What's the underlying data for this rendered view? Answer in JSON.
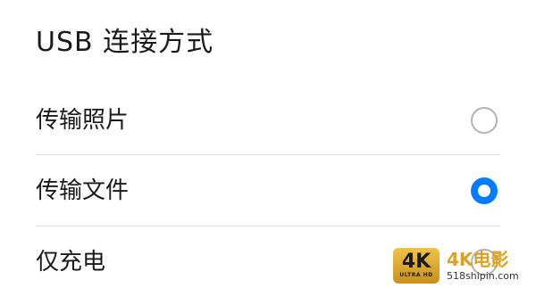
{
  "dialog": {
    "title": "USB 连接方式",
    "options": [
      {
        "label": "传输照片",
        "selected": false
      },
      {
        "label": "传输文件",
        "selected": true
      },
      {
        "label": "仅充电",
        "selected": false
      }
    ]
  },
  "colors": {
    "accent": "#007dff",
    "radio_border": "#b3b3b3",
    "divider": "#e6e6e6"
  },
  "watermark": {
    "badge_big": "4K",
    "badge_small": "ULTRA HD",
    "brand": "4K电影",
    "site": "518shipin.com"
  }
}
